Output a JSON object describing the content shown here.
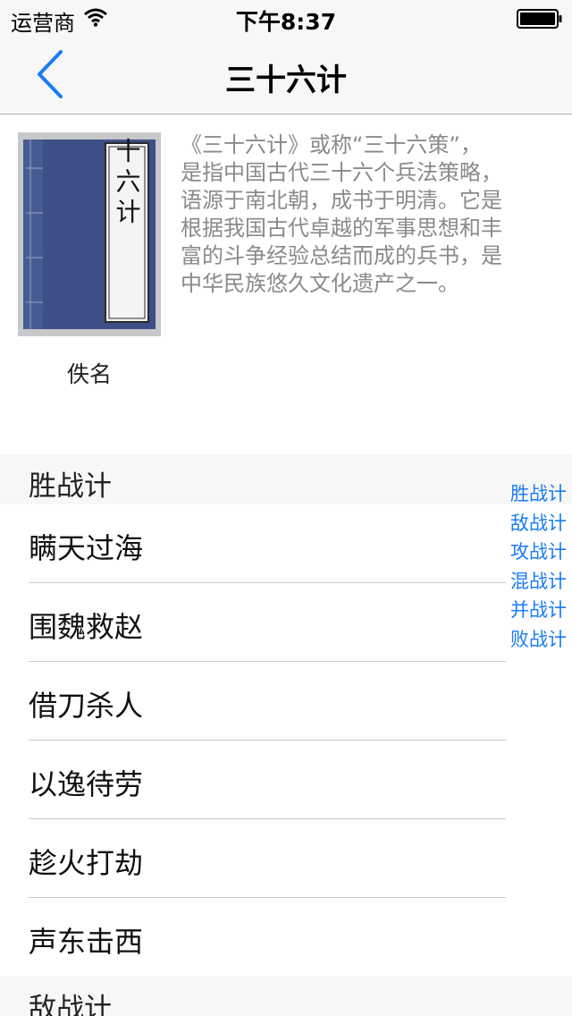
{
  "status_bar": {
    "carrier": "运营商",
    "time": "下午8:37"
  },
  "nav": {
    "title": "三十六计",
    "back_icon": "chevron-left-icon"
  },
  "book": {
    "cover_title": "三十六计",
    "author": "佚名",
    "description_lines": [
      "《三十六计》或称“三十六策”，",
      "是指中国古代三十六个兵法策略，",
      "语源于南北朝，成书于明清。它是",
      "根据我国古代卓越的军事思想和丰",
      "富的斗争经验总结而成的兵书，是",
      "中华民族悠久文化遗产之一。"
    ]
  },
  "sections": [
    {
      "title": "胜战计",
      "rows": [
        "瞒天过海",
        "围魏救赵",
        "借刀杀人",
        "以逸待劳",
        "趁火打劫",
        "声东击西"
      ]
    },
    {
      "title": "敌战计",
      "rows": []
    }
  ],
  "section_index": [
    "胜战计",
    "敌战计",
    "攻战计",
    "混战计",
    "并战计",
    "败战计"
  ],
  "colors": {
    "accent": "#1a7cf5",
    "bar_background": "#f7f7f7",
    "description_text": "#8a8a8a",
    "separator": "#c8c7cc",
    "cover_blue": "#3d4f86"
  }
}
